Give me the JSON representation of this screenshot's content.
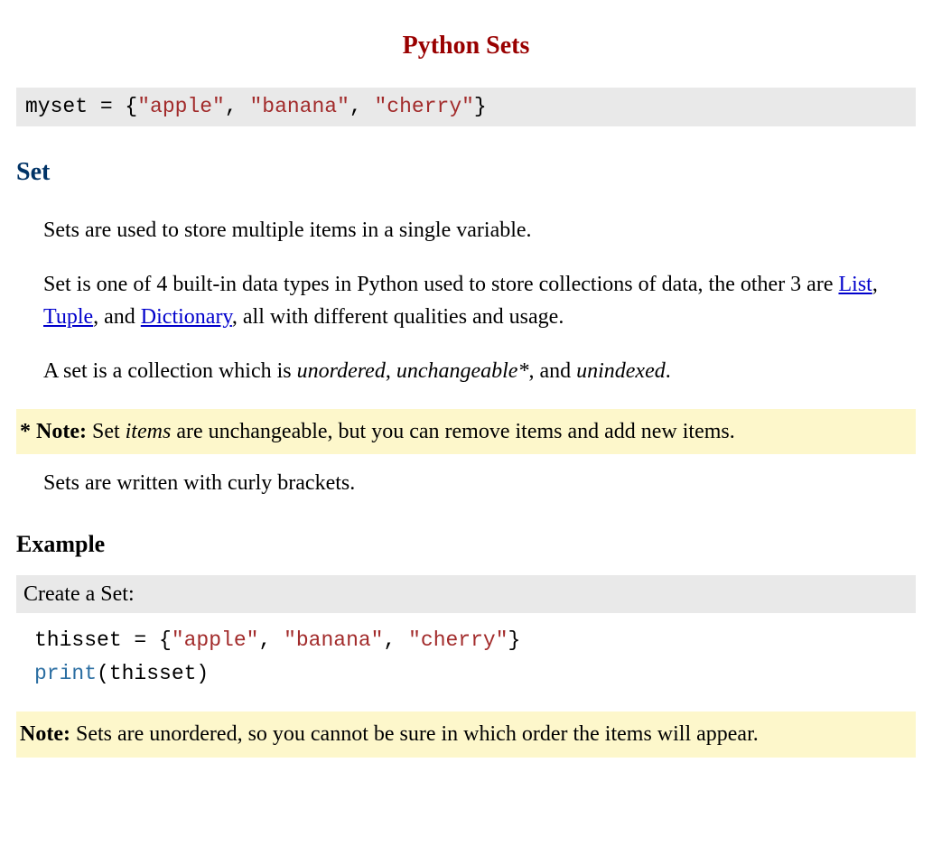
{
  "title": "Python Sets",
  "topcode": {
    "lhs": "myset = {",
    "s1": "\"apple\"",
    "c1": ", ",
    "s2": "\"banana\"",
    "c2": ", ",
    "s3": "\"cherry\"",
    "rhs": "}"
  },
  "section_heading": "Set",
  "para1": "Sets are used to store multiple items in a single variable.",
  "para2": {
    "before": "Set is one of 4 built-in data types in Python used to store collections of data, the other 3 are ",
    "link1": "List",
    "sep1": ", ",
    "link2": "Tuple",
    "sep2": ", and ",
    "link3": "Dictionary",
    "after": ", all with different qualities and usage."
  },
  "para3": {
    "before": "A set is a collection which is ",
    "em1": "unordered",
    "comma1": ", ",
    "em2": "unchangeable*",
    "comma2": ", and ",
    "em3": "unindexed",
    "end": "."
  },
  "note1": {
    "label": "* Note:",
    "before": " Set ",
    "em": "items",
    "after": " are unchangeable, but you can remove items and add new items."
  },
  "para4": "Sets are written with curly brackets.",
  "example": {
    "heading": "Example",
    "caption": "Create a Set:",
    "code": {
      "line1_lhs": "thisset = {",
      "s1": "\"apple\"",
      "c1": ", ",
      "s2": "\"banana\"",
      "c2": ", ",
      "s3": "\"cherry\"",
      "rhs": "}",
      "line2_func": "print",
      "line2_rest": "(thisset)"
    }
  },
  "note2": {
    "label": "Note:",
    "text": " Sets are unordered, so you cannot be sure in which order the items will appear."
  }
}
